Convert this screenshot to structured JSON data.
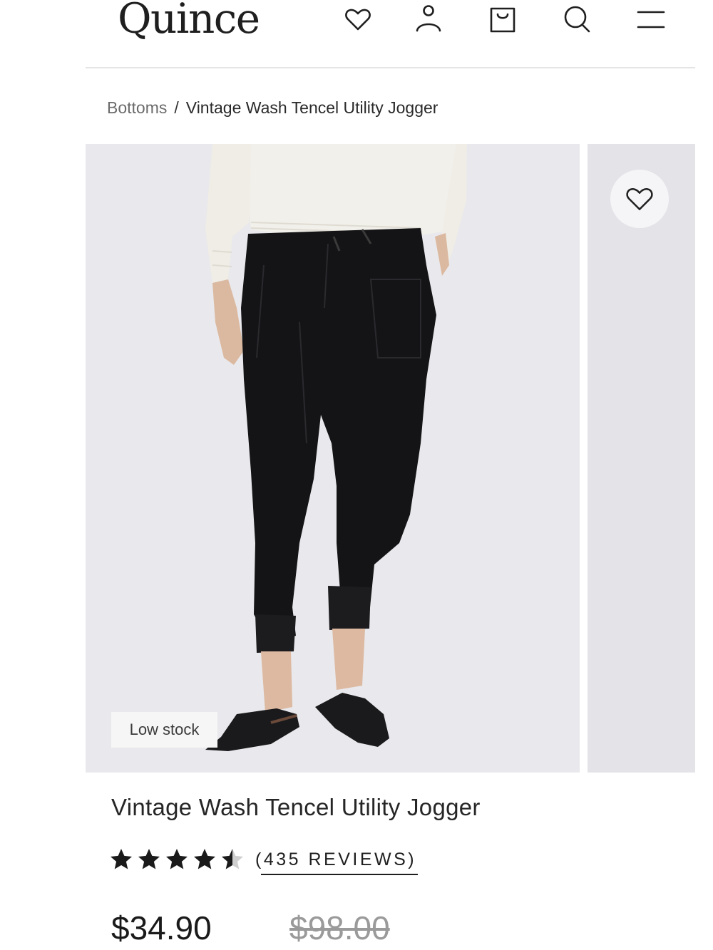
{
  "header": {
    "logo": "Quince",
    "icons": [
      "heart-icon",
      "account-icon",
      "bag-icon",
      "search-icon",
      "menu-icon"
    ]
  },
  "breadcrumb": {
    "parent": "Bottoms",
    "separator": "/",
    "current": "Vintage Wash Tencel Utility Jogger"
  },
  "gallery": {
    "badge": "Low stock",
    "background": "#e9e8ec"
  },
  "product": {
    "title": "Vintage Wash Tencel Utility Jogger",
    "rating": 4.5,
    "reviews_label": "(435 REVIEWS)",
    "price": "$34.90",
    "original_price": "$98.00"
  }
}
